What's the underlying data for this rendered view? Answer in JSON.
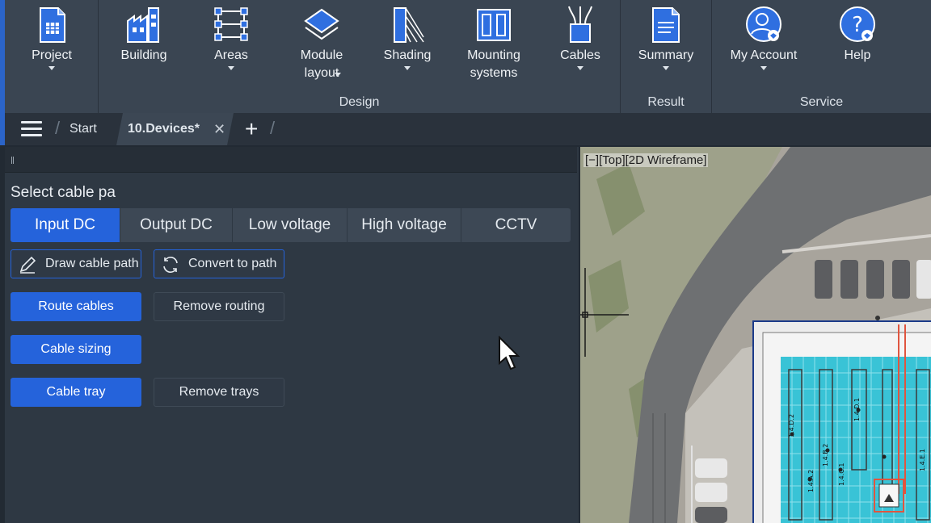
{
  "ribbon": {
    "buttons": [
      {
        "label": "Project",
        "icon": "project-icon",
        "dropdown": true
      },
      {
        "label": "Building",
        "icon": "building-icon",
        "dropdown": false
      },
      {
        "label": "Areas",
        "icon": "areas-icon",
        "dropdown": true
      },
      {
        "label": "Module\nlayout",
        "icon": "module-layout-icon",
        "dropdown": true
      },
      {
        "label": "Shading",
        "icon": "shading-icon",
        "dropdown": true
      },
      {
        "label": "Mounting\nsystems",
        "icon": "mounting-systems-icon",
        "dropdown": false
      },
      {
        "label": "Cables",
        "icon": "cables-icon",
        "dropdown": true
      },
      {
        "label": "Summary",
        "icon": "summary-icon",
        "dropdown": true
      },
      {
        "label": "My Account",
        "icon": "account-icon",
        "dropdown": true
      },
      {
        "label": "Help",
        "icon": "help-icon",
        "dropdown": false
      }
    ],
    "groups": {
      "design": "Design",
      "result": "Result",
      "service": "Service"
    }
  },
  "tabs": {
    "start": "Start",
    "active": "10.Devices*",
    "close": "✕",
    "add": "+"
  },
  "panel": {
    "title": "Select cable pa",
    "segments": [
      {
        "label": "Input DC",
        "active": true
      },
      {
        "label": "Output DC",
        "active": false
      },
      {
        "label": "Low voltage",
        "active": false
      },
      {
        "label": "High voltage",
        "active": false
      },
      {
        "label": "CCTV",
        "active": false
      }
    ],
    "draw_cable_path": "Draw cable path",
    "convert_to_path": "Convert to path",
    "route_cables": "Route cables",
    "remove_routing": "Remove routing",
    "cable_sizing": "Cable sizing",
    "cable_tray": "Cable tray",
    "remove_trays": "Remove trays"
  },
  "viewport": {
    "label": "[−][Top][2D Wireframe]",
    "string_labels": [
      "1.4.D.1",
      "1.4.B.2",
      "1.4.A.2",
      "1.4.E.1",
      "1.4.C.1",
      "1.4.D.2"
    ]
  },
  "colors": {
    "accent": "#2563db",
    "ribbon": "#3a4552",
    "panel": "#2e3843",
    "module_fill": "#39c3d6",
    "route_line": "#e0553f"
  }
}
